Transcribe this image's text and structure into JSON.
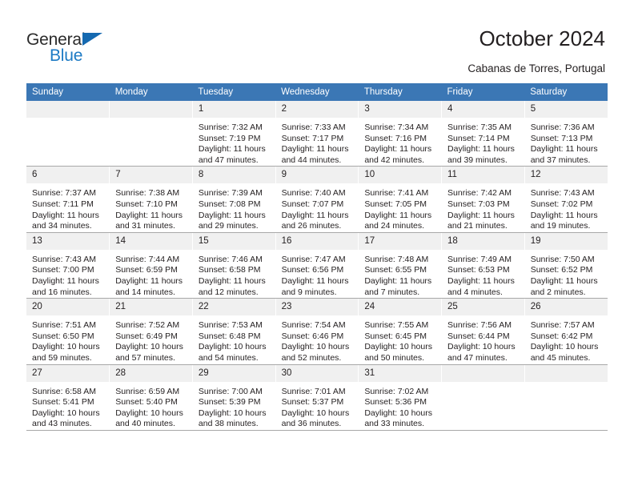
{
  "brand": {
    "name_top": "General",
    "name_bottom": "Blue",
    "triangle_color": "#1569b0",
    "blue_color": "#1c7ac4"
  },
  "header": {
    "title": "October 2024",
    "subtitle": "Cabanas de Torres, Portugal",
    "header_bg": "#3b77b5",
    "daynum_bg": "#f0f0f0"
  },
  "weekday_headers": [
    "Sunday",
    "Monday",
    "Tuesday",
    "Wednesday",
    "Thursday",
    "Friday",
    "Saturday"
  ],
  "labels": {
    "sunrise_prefix": "Sunrise:",
    "sunset_prefix": "Sunset:",
    "daylight_prefix": "Daylight:"
  },
  "weeks": [
    [
      {
        "day": "",
        "empty": true
      },
      {
        "day": "",
        "empty": true
      },
      {
        "day": "1",
        "sunrise": "Sunrise: 7:32 AM",
        "sunset": "Sunset: 7:19 PM",
        "daylight1": "Daylight: 11 hours",
        "daylight2": "and 47 minutes."
      },
      {
        "day": "2",
        "sunrise": "Sunrise: 7:33 AM",
        "sunset": "Sunset: 7:17 PM",
        "daylight1": "Daylight: 11 hours",
        "daylight2": "and 44 minutes."
      },
      {
        "day": "3",
        "sunrise": "Sunrise: 7:34 AM",
        "sunset": "Sunset: 7:16 PM",
        "daylight1": "Daylight: 11 hours",
        "daylight2": "and 42 minutes."
      },
      {
        "day": "4",
        "sunrise": "Sunrise: 7:35 AM",
        "sunset": "Sunset: 7:14 PM",
        "daylight1": "Daylight: 11 hours",
        "daylight2": "and 39 minutes."
      },
      {
        "day": "5",
        "sunrise": "Sunrise: 7:36 AM",
        "sunset": "Sunset: 7:13 PM",
        "daylight1": "Daylight: 11 hours",
        "daylight2": "and 37 minutes."
      }
    ],
    [
      {
        "day": "6",
        "sunrise": "Sunrise: 7:37 AM",
        "sunset": "Sunset: 7:11 PM",
        "daylight1": "Daylight: 11 hours",
        "daylight2": "and 34 minutes."
      },
      {
        "day": "7",
        "sunrise": "Sunrise: 7:38 AM",
        "sunset": "Sunset: 7:10 PM",
        "daylight1": "Daylight: 11 hours",
        "daylight2": "and 31 minutes."
      },
      {
        "day": "8",
        "sunrise": "Sunrise: 7:39 AM",
        "sunset": "Sunset: 7:08 PM",
        "daylight1": "Daylight: 11 hours",
        "daylight2": "and 29 minutes."
      },
      {
        "day": "9",
        "sunrise": "Sunrise: 7:40 AM",
        "sunset": "Sunset: 7:07 PM",
        "daylight1": "Daylight: 11 hours",
        "daylight2": "and 26 minutes."
      },
      {
        "day": "10",
        "sunrise": "Sunrise: 7:41 AM",
        "sunset": "Sunset: 7:05 PM",
        "daylight1": "Daylight: 11 hours",
        "daylight2": "and 24 minutes."
      },
      {
        "day": "11",
        "sunrise": "Sunrise: 7:42 AM",
        "sunset": "Sunset: 7:03 PM",
        "daylight1": "Daylight: 11 hours",
        "daylight2": "and 21 minutes."
      },
      {
        "day": "12",
        "sunrise": "Sunrise: 7:43 AM",
        "sunset": "Sunset: 7:02 PM",
        "daylight1": "Daylight: 11 hours",
        "daylight2": "and 19 minutes."
      }
    ],
    [
      {
        "day": "13",
        "sunrise": "Sunrise: 7:43 AM",
        "sunset": "Sunset: 7:00 PM",
        "daylight1": "Daylight: 11 hours",
        "daylight2": "and 16 minutes."
      },
      {
        "day": "14",
        "sunrise": "Sunrise: 7:44 AM",
        "sunset": "Sunset: 6:59 PM",
        "daylight1": "Daylight: 11 hours",
        "daylight2": "and 14 minutes."
      },
      {
        "day": "15",
        "sunrise": "Sunrise: 7:46 AM",
        "sunset": "Sunset: 6:58 PM",
        "daylight1": "Daylight: 11 hours",
        "daylight2": "and 12 minutes."
      },
      {
        "day": "16",
        "sunrise": "Sunrise: 7:47 AM",
        "sunset": "Sunset: 6:56 PM",
        "daylight1": "Daylight: 11 hours",
        "daylight2": "and 9 minutes."
      },
      {
        "day": "17",
        "sunrise": "Sunrise: 7:48 AM",
        "sunset": "Sunset: 6:55 PM",
        "daylight1": "Daylight: 11 hours",
        "daylight2": "and 7 minutes."
      },
      {
        "day": "18",
        "sunrise": "Sunrise: 7:49 AM",
        "sunset": "Sunset: 6:53 PM",
        "daylight1": "Daylight: 11 hours",
        "daylight2": "and 4 minutes."
      },
      {
        "day": "19",
        "sunrise": "Sunrise: 7:50 AM",
        "sunset": "Sunset: 6:52 PM",
        "daylight1": "Daylight: 11 hours",
        "daylight2": "and 2 minutes."
      }
    ],
    [
      {
        "day": "20",
        "sunrise": "Sunrise: 7:51 AM",
        "sunset": "Sunset: 6:50 PM",
        "daylight1": "Daylight: 10 hours",
        "daylight2": "and 59 minutes."
      },
      {
        "day": "21",
        "sunrise": "Sunrise: 7:52 AM",
        "sunset": "Sunset: 6:49 PM",
        "daylight1": "Daylight: 10 hours",
        "daylight2": "and 57 minutes."
      },
      {
        "day": "22",
        "sunrise": "Sunrise: 7:53 AM",
        "sunset": "Sunset: 6:48 PM",
        "daylight1": "Daylight: 10 hours",
        "daylight2": "and 54 minutes."
      },
      {
        "day": "23",
        "sunrise": "Sunrise: 7:54 AM",
        "sunset": "Sunset: 6:46 PM",
        "daylight1": "Daylight: 10 hours",
        "daylight2": "and 52 minutes."
      },
      {
        "day": "24",
        "sunrise": "Sunrise: 7:55 AM",
        "sunset": "Sunset: 6:45 PM",
        "daylight1": "Daylight: 10 hours",
        "daylight2": "and 50 minutes."
      },
      {
        "day": "25",
        "sunrise": "Sunrise: 7:56 AM",
        "sunset": "Sunset: 6:44 PM",
        "daylight1": "Daylight: 10 hours",
        "daylight2": "and 47 minutes."
      },
      {
        "day": "26",
        "sunrise": "Sunrise: 7:57 AM",
        "sunset": "Sunset: 6:42 PM",
        "daylight1": "Daylight: 10 hours",
        "daylight2": "and 45 minutes."
      }
    ],
    [
      {
        "day": "27",
        "sunrise": "Sunrise: 6:58 AM",
        "sunset": "Sunset: 5:41 PM",
        "daylight1": "Daylight: 10 hours",
        "daylight2": "and 43 minutes."
      },
      {
        "day": "28",
        "sunrise": "Sunrise: 6:59 AM",
        "sunset": "Sunset: 5:40 PM",
        "daylight1": "Daylight: 10 hours",
        "daylight2": "and 40 minutes."
      },
      {
        "day": "29",
        "sunrise": "Sunrise: 7:00 AM",
        "sunset": "Sunset: 5:39 PM",
        "daylight1": "Daylight: 10 hours",
        "daylight2": "and 38 minutes."
      },
      {
        "day": "30",
        "sunrise": "Sunrise: 7:01 AM",
        "sunset": "Sunset: 5:37 PM",
        "daylight1": "Daylight: 10 hours",
        "daylight2": "and 36 minutes."
      },
      {
        "day": "31",
        "sunrise": "Sunrise: 7:02 AM",
        "sunset": "Sunset: 5:36 PM",
        "daylight1": "Daylight: 10 hours",
        "daylight2": "and 33 minutes."
      },
      {
        "day": "",
        "empty": true
      },
      {
        "day": "",
        "empty": true
      }
    ]
  ]
}
